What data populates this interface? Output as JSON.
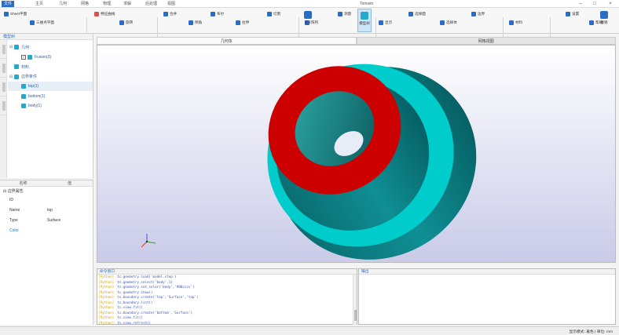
{
  "window": {
    "title": "Tomsim",
    "menu_tabs": [
      "文件",
      "主页",
      "几何",
      "网格",
      "物理",
      "求解",
      "后处理",
      "视图"
    ],
    "active_tab_index": 0,
    "controls": {
      "minimize": "–",
      "maximize": "□",
      "close": "×"
    }
  },
  "ribbon": {
    "items": [
      {
        "label": "Sheet平面",
        "icon": "sheet-icon",
        "color": "#2b6cc4"
      },
      {
        "label": "三维点平面",
        "icon": "point-plane-icon",
        "color": "#2b6cc4"
      },
      {
        "label": "特征曲线",
        "icon": "curve-icon",
        "color": "#d9534f"
      },
      {
        "label": "旋转",
        "icon": "rotate-icon",
        "color": "#2b6cc4"
      },
      {
        "label": "合并",
        "icon": "merge-icon",
        "color": "#2b6cc4"
      },
      {
        "label": "倒角",
        "icon": "chamfer-icon",
        "color": "#2b6cc4"
      },
      {
        "label": "布尔",
        "icon": "boolean-icon",
        "color": "#2b6cc4"
      },
      {
        "label": "拉伸",
        "icon": "extrude-icon",
        "color": "#2b6cc4"
      },
      {
        "label": "切割",
        "icon": "cut-icon",
        "color": "#2b6cc4"
      },
      {
        "label": "阵列",
        "icon": "array-icon",
        "color": "#2b6cc4"
      },
      {
        "label": "测量",
        "icon": "measure-icon",
        "color": "#2b6cc4"
      },
      {
        "label": "显示",
        "icon": "display-icon",
        "color": "#2b6cc4"
      },
      {
        "label": "选择面",
        "icon": "select-face-icon",
        "color": "#2b6cc4"
      },
      {
        "label": "选择体",
        "icon": "select-body-icon",
        "color": "#2b6cc4"
      },
      {
        "label": "边界",
        "icon": "boundary-icon",
        "color": "#2b6cc4"
      },
      {
        "label": "材料",
        "icon": "material-icon",
        "color": "#2b6cc4"
      },
      {
        "label": "设置",
        "icon": "settings-icon",
        "color": "#2b6cc4"
      },
      {
        "label": "帮助",
        "icon": "help-icon",
        "color": "#2b6cc4"
      }
    ],
    "big_buttons": [
      {
        "label": "定义",
        "icon": "define-icon",
        "color": "#2b6cc4"
      },
      {
        "label": "模型树",
        "icon": "model-tree-icon",
        "color": "#23a9c9"
      },
      {
        "label": "撤销",
        "icon": "undo-icon",
        "color": "#2b6cc4"
      }
    ]
  },
  "model_tree": {
    "header": "模型树",
    "rows": [
      {
        "label": "几何",
        "twisty": "⊟",
        "checkbox": false,
        "cube": true,
        "level": 0
      },
      {
        "label": "Fusion(3)",
        "twisty": "",
        "checkbox": true,
        "cube": true,
        "level": 1
      },
      {
        "label": "材料",
        "twisty": "",
        "checkbox": false,
        "cube": true,
        "level": 0
      },
      {
        "label": "边界条件",
        "twisty": "⊟",
        "checkbox": false,
        "cube": true,
        "level": 0
      },
      {
        "label": "top(1)",
        "twisty": "",
        "checkbox": false,
        "cube": true,
        "level": 1,
        "selected": true
      },
      {
        "label": "bottom(1)",
        "twisty": "",
        "checkbox": false,
        "cube": true,
        "level": 1
      },
      {
        "label": "body(1)",
        "twisty": "",
        "checkbox": false,
        "cube": true,
        "level": 1
      }
    ]
  },
  "properties": {
    "header_name": "名称",
    "header_value": "值",
    "group": "⊟ 边界属性",
    "rows": [
      {
        "label": "ID",
        "value": ""
      },
      {
        "label": "Name",
        "value": "top"
      },
      {
        "label": "Type",
        "value": "Surface"
      },
      {
        "label": "Color",
        "value": ""
      }
    ]
  },
  "viewport": {
    "tabs": [
      "几何体",
      "网格视图"
    ],
    "active_tab_index": 0,
    "model_colors": {
      "top_face": "#cc0000",
      "flange_face": "#00cccc",
      "body_side": "#008b8b"
    }
  },
  "console": {
    "header": "命令窗口",
    "lines": [
      {
        "tag": "[Python]",
        "msg": "tc.geometry.load('model.step')"
      },
      {
        "tag": "[Python]",
        "msg": "tc.geometry.select('body',1)"
      },
      {
        "tag": "[Python]",
        "msg": "tc.geometry.set_color('body','#00cccc')"
      },
      {
        "tag": "[Python]",
        "msg": "tc.geometry.show()"
      },
      {
        "tag": "[Python]",
        "msg": "tc.boundary.create('top','Surface','top')"
      },
      {
        "tag": "[Python]",
        "msg": "tc.boundary.list()"
      },
      {
        "tag": "[Python]",
        "msg": "tc.view.fit()"
      },
      {
        "tag": "[Python]",
        "msg": "tc.boundary.create('bottom','Surface')"
      },
      {
        "tag": "[Python]",
        "msg": "tc.view.fit()"
      },
      {
        "tag": "[Python]",
        "msg": "tc.view.refresh()"
      }
    ]
  },
  "output": {
    "header": "输出"
  },
  "status": {
    "text": "显示模式: 着色 | 单位: mm"
  }
}
